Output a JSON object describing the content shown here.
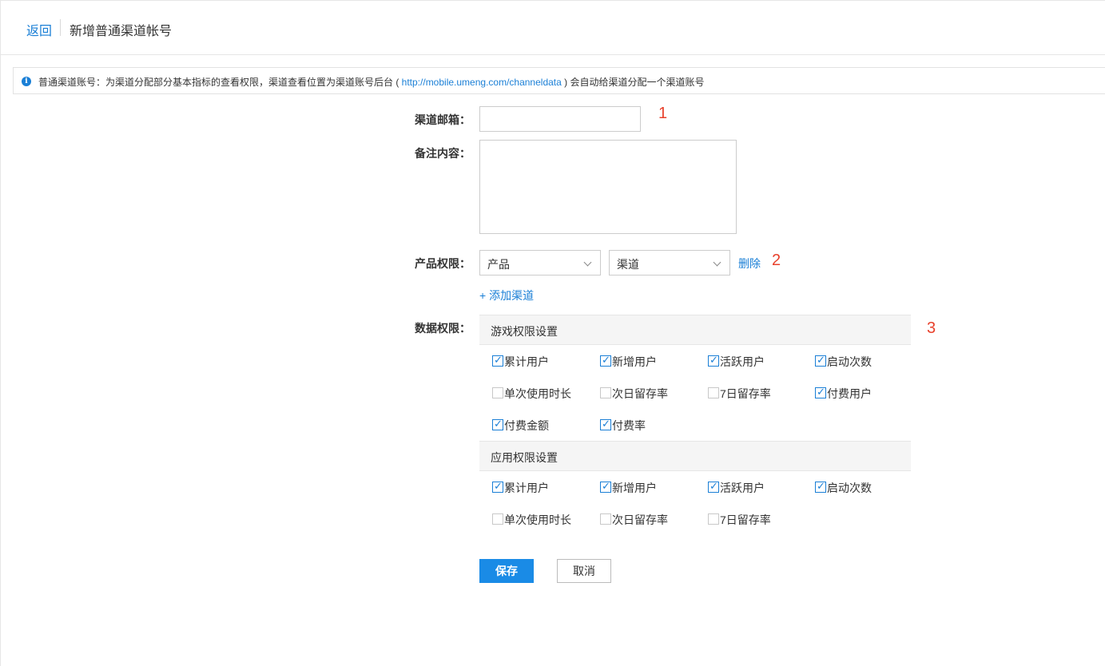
{
  "header": {
    "back_label": "返回",
    "title": "新增普通渠道帐号"
  },
  "info": {
    "text_before": "普通渠道账号：为渠道分配部分基本指标的查看权限，渠道查看位置为渠道账号后台 ( ",
    "link": "http://mobile.umeng.com/channeldata",
    "text_after": " ) 会自动给渠道分配一个渠道账号",
    "icon": "info-icon"
  },
  "form": {
    "email_label": "渠道邮箱：",
    "email_value": "",
    "notes_label": "备注内容：",
    "notes_value": "",
    "product_perm_label": "产品权限：",
    "product_select": "产品",
    "channel_select": "渠道",
    "delete_label": "删除",
    "add_channel_label": "+ 添加渠道",
    "data_perm_label": "数据权限："
  },
  "annotations": [
    "1",
    "2",
    "3"
  ],
  "game_perms": {
    "title": "游戏权限设置",
    "items": [
      {
        "label": "累计用户",
        "checked": true
      },
      {
        "label": "新增用户",
        "checked": true
      },
      {
        "label": "活跃用户",
        "checked": true
      },
      {
        "label": "启动次数",
        "checked": true
      },
      {
        "label": "单次使用时长",
        "checked": false
      },
      {
        "label": "次日留存率",
        "checked": false
      },
      {
        "label": "7日留存率",
        "checked": false
      },
      {
        "label": "付费用户",
        "checked": true
      },
      {
        "label": "付费金额",
        "checked": true
      },
      {
        "label": "付费率",
        "checked": true
      }
    ]
  },
  "app_perms": {
    "title": "应用权限设置",
    "items": [
      {
        "label": "累计用户",
        "checked": true
      },
      {
        "label": "新增用户",
        "checked": true
      },
      {
        "label": "活跃用户",
        "checked": true
      },
      {
        "label": "启动次数",
        "checked": true
      },
      {
        "label": "单次使用时长",
        "checked": false
      },
      {
        "label": "次日留存率",
        "checked": false
      },
      {
        "label": "7日留存率",
        "checked": false
      }
    ]
  },
  "buttons": {
    "save_label": "保存",
    "cancel_label": "取消"
  },
  "colors": {
    "accent": "#1a7fd6",
    "primary_button": "#1a8be6",
    "annotation": "#e8412c"
  }
}
